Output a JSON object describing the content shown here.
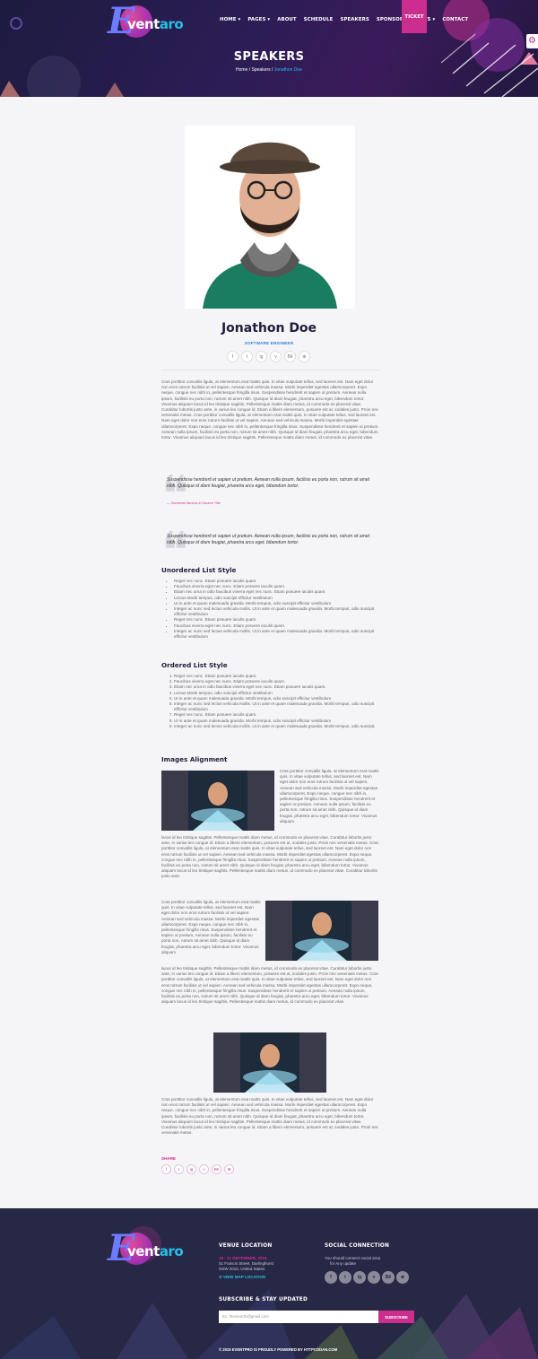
{
  "brand": {
    "logo_e": "E",
    "logo_vent": "vent",
    "logo_aro": "aro"
  },
  "nav": {
    "items": [
      "HOME ▾",
      "PAGES ▾",
      "ABOUT",
      "SCHEDULE",
      "SPEAKERS",
      "SPONSORS",
      "NEWS ▾",
      "CONTACT"
    ],
    "ticket": "TICKET"
  },
  "page": {
    "title": "SPEAKERS",
    "breadcrumb": {
      "home": "Home",
      "sep": "/",
      "section": "Speakers",
      "current": "Jonathon Doe"
    }
  },
  "speaker": {
    "name": "Jonathon Doe",
    "role": "SOFTWARE ENGINEER",
    "socials": [
      "f",
      "t",
      "ig",
      "v",
      "Bē",
      "⊕"
    ]
  },
  "content": {
    "intro": "Cras porttitor convallis ligula, at elementum erat mattis quis. In vitae vulputate tellus, sed laoreet est. Nam eget dolor non eros rutrum facilisis ut vel sapien. Aenean sed vehicula massa. Morbi imperdiet egestas ullamcorperet. Expo neque, congue nec nibh in, pellentesque fringilla risus. Suspendisse hendrerit et sapien ut pretium. Aenean nulla ipsum, facilisis eu porta non, rutrum sit amet nibh. Quisque id diam feugiat, pharetra arcu eget, bibendum tortor. Vivamus aliquam lacus id leo tristique sagittis. Pellentesque mattis diam metus, id commodo ex placerat vitae. Curabitur lobortis justo ante, in varius leo congue id. Etiam a libero elementum, posuere est at, sodales justo. Proin nec venenatis metus. Cras porttitor convallis ligula, at elementum erat mattis quis. In vitae vulputate tellus, sed laoreet est. Nam eget dolor non eros rutrum facilisis ut vel sapien. Aenean sed vehicula massa. Morbi imperdiet egestas ullamcorperet. Expo neque, congue nec nibh in, pellentesque fringilla risus. Suspendisse hendrerit et sapien ut pretium. Aenean nulla ipsum, facilisis eu porta non, rutrum sit amet nibh. Quisque id diam feugiat, pharetra arcu eget, bibendum tortor. Vivamus aliquam lacus id leo tristique sagittis. Pellentesque mattis diam metus, id commodo ex placerat vitae.",
    "quote1": "Suspendisse hendrerit et sapien ut pretium. Aenean nulla ipsum, facilisis eu porta non, rutrum sit amet nibh. Quisque id diam feugiat, pharetra arcu eget, bibendum tortor.",
    "quote1_source": "— Someone famous in Source Title",
    "quote2": "Suspendisse hendrerit et sapien ut pretium. Aenean nulla ipsum, facilisis eu porta non, rutrum sit amet nibh. Quisque id diam feugiat, pharetra arcu eget, bibendum tortor.",
    "ul_title": "Unordered List Style",
    "ul": [
      "Reget nec nunc. Etiam posuere iaculis quam.",
      "Faucibus viverra eget nec nunc. Etiam posuere iaculis quam.",
      "Etiam nec urna in odio faucibus viverra eget nec nunc. Etiam posuere iaculis quam.",
      "Lectus Morbi tempus, odio suscipit efficitur vestibulum",
      "Ut in ante et quam malesuada gravida. Morbi tempus, odio suscipit efficitur vestibulum",
      "Integer ac nunc sed lectus vehicula mollis. Ut in ante et quam malesuada gravida. Morbi tempus, odio suscipit efficitur vestibulum",
      "Reget nec nunc. Etiam posuere iaculis quam.",
      "Faucibus viverra eget nec nunc. Etiam posuere iaculis quam.",
      "Integer ac nunc sed lectus vehicula mollis. Ut in ante et quam malesuada gravida. Morbi tempus, odio suscipit efficitur vestibulum"
    ],
    "ol_title": "Ordered List Style",
    "ol": [
      "Reget nec nunc. Etiam posuere iaculis quam.",
      "Faucibus viverra eget nec nunc. Etiam posuere iaculis quam.",
      "Etiam nec urna in odio faucibus viverra eget nec nunc. Etiam posuere iaculis quam.",
      "Lectus Morbi tempus, odio suscipit efficitur vestibulum",
      "Ut in ante et quam malesuada gravida. Morbi tempus, odio suscipit efficitur vestibulum",
      "Integer ac nunc sed lectus vehicula mollis. Ut in ante et quam malesuada gravida. Morbi tempus, odio suscipit efficitur vestibulum",
      "Reget nec nunc. Etiam posuere iaculis quam.",
      "Ut in ante et quam malesuada gravida. Morbi tempus, odio suscipit efficitur vestibulum",
      "Integer ac nunc sed lectus vehicula mollis. Ut in ante et quam malesuada gravida. Morbi tempus, odio suscipit."
    ],
    "img_title": "Images Alignment",
    "img_text1": "Cras porttitor convallis ligula, at elementum erat mattis quis. In vitae vulputate tellus, sed laoreet est. Nam eget dolor non eros rutrum facilisis ut vel sapien. Aenean sed vehicula massa. Morbi imperdiet egestas ullamcorperet. Expo neque, congue nec nibh in, pellentesque fringilla risus. Suspendisse hendrerit et sapien ut pretium. Aenean nulla ipsum, facilisis eu porta non, rutrum sit amet nibh. Quisque id diam feugiat, pharetra arcu eget, bibendum tortor. Vivamus aliquam",
    "img_text1b": "lacus id leo tristique sagittis. Pellentesque mattis diam metus, id commodo ex placerat vitae. Curabitur lobortis justo ante, in varius leo congue id. Etiam a libero elementum, posuere est at, sodales justo. Proin nec venenatis metus. Cras porttitor convallis ligula, at elementum erat mattis quis. In vitae vulputate tellus, sed laoreet est. Nam eget dolor non eros rutrum facilisis ut vel sapien. Aenean sed vehicula massa. Morbi imperdiet egestas ullamcorperet. Expo neque, congue nec nibh in, pellentesque fringilla risus. Suspendisse hendrerit et sapien ut pretium. Aenean nulla ipsum, facilisis eu porta non, rutrum sit amet nibh. Quisque id diam feugiat, pharetra arcu eget, bibendum tortor. Vivamus aliquam lacus id leo tristique sagittis. Pellentesque mattis diam metus, id commodo ex placerat vitae. Curabitur lobortis justo ante.",
    "img_text2": "Cras porttitor convallis ligula, at elementum erat mattis quis. In vitae vulputate tellus, sed laoreet est. Nam eget dolor non eros rutrum facilisis ut vel sapien. Aenean sed vehicula massa. Morbi imperdiet egestas ullamcorperet. Expo neque, congue nec nibh in, pellentesque fringilla risus. Suspendisse hendrerit et sapien ut pretium. Aenean nulla ipsum, facilisis eu porta non, rutrum sit amet nibh. Quisque id diam feugiat, pharetra arcu eget, bibendum tortor. Vivamus aliquam",
    "img_text2b": "lacus id leo tristique sagittis. Pellentesque mattis diam metus, id commodo ex placerat vitae. Curabitur lobortis justo ante, in varius leo congue id. Etiam a libero elementum, posuere est at, sodales justo. Proin nec venenatis metus. Cras porttitor convallis ligula, at elementum erat mattis quis. In vitae vulputate tellus, sed laoreet est. Nam eget dolor non eros rutrum facilisis ut vel sapien. Aenean sed vehicula massa. Morbi imperdiet egestas ullamcorperet. Expo neque, congue nec nibh in, pellentesque fringilla risus. Suspendisse hendrerit et sapien ut pretium. Aenean nulla ipsum, facilisis eu porta non, rutrum sit amet nibh. Quisque id diam feugiat, pharetra arcu eget, bibendum tortor. Vivamus aliquam lacus id leo tristique sagittis. Pellentesque mattis diam metus, id commodo ex placerat vitae.",
    "img_text3": "Cras porttitor convallis ligula, at elementum erat mattis quis. In vitae vulputate tellus, sed laoreet est. Nam eget dolor non eros rutrum facilisis ut vel sapien. Aenean sed vehicula massa. Morbi imperdiet egestas ullamcorperet. Expo neque, congue nec nibh in, pellentesque fringilla risus. Suspendisse hendrerit et sapien ut pretium. Aenean nulla ipsum, facilisis eu porta non, rutrum sit amet nibh. Quisque id diam feugiat, pharetra arcu eget, bibendum tortor. Vivamus aliquam lacus id leo tristique sagittis. Pellentesque mattis diam metus, id commodo ex placerat vitae. Curabitur lobortis justo ante, in varius leo congue id. Etiam a libero elementum, posuere est at, sodales justo. Proin nec venenatis metus.",
    "share_label": "SHARE"
  },
  "footer": {
    "venue_title": "VENUE LOCATION",
    "venue_date": "19 - 21 DECEMBER, 2019",
    "venue_addr1": "51 Francis Street, Darlinghurst",
    "venue_addr2": "NSW 2010, United States",
    "venue_map": "⊙ VIEW MAP LOCATION",
    "social_title": "SOCIAL CONNECTION",
    "social_text1": "You should connect social area",
    "social_text2": "for Any update",
    "social_icons": [
      "f",
      "t",
      "ig",
      "v",
      "Bē",
      "⊕"
    ],
    "subscribe_title": "SUBSCRIBE & STAY UPDATED",
    "email_placeholder": "Ex. themearth@gmail.com",
    "subscribe_button": "SUBSCRIBE",
    "copyright": "© 2015 EVENTPRO IS PROUDLY POWERED BY HTTPCODAN.COM"
  },
  "colors": {
    "accent": "#cc2e8f",
    "link": "#2a7fd6",
    "dark": "#1f1d3a",
    "footer_bg": "#262845"
  }
}
